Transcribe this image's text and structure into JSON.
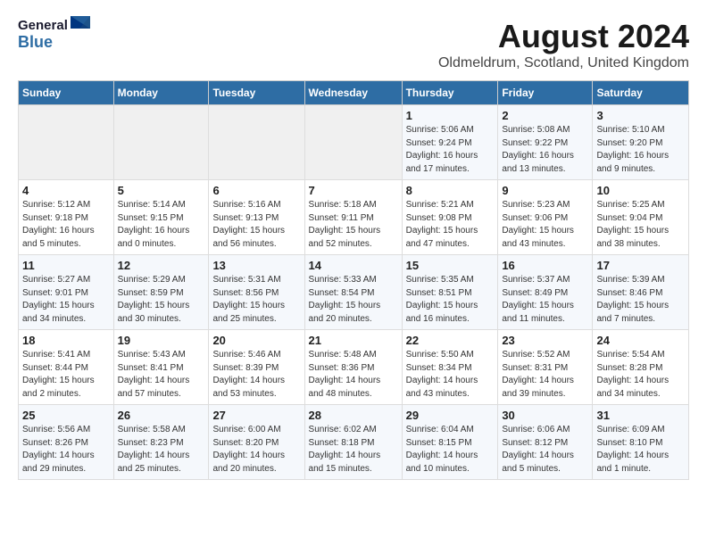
{
  "header": {
    "logo_general": "General",
    "logo_blue": "Blue",
    "title": "August 2024",
    "subtitle": "Oldmeldrum, Scotland, United Kingdom"
  },
  "days_of_week": [
    "Sunday",
    "Monday",
    "Tuesday",
    "Wednesday",
    "Thursday",
    "Friday",
    "Saturday"
  ],
  "weeks": [
    [
      {
        "day": "",
        "info": ""
      },
      {
        "day": "",
        "info": ""
      },
      {
        "day": "",
        "info": ""
      },
      {
        "day": "",
        "info": ""
      },
      {
        "day": "1",
        "info": "Sunrise: 5:06 AM\nSunset: 9:24 PM\nDaylight: 16 hours\nand 17 minutes."
      },
      {
        "day": "2",
        "info": "Sunrise: 5:08 AM\nSunset: 9:22 PM\nDaylight: 16 hours\nand 13 minutes."
      },
      {
        "day": "3",
        "info": "Sunrise: 5:10 AM\nSunset: 9:20 PM\nDaylight: 16 hours\nand 9 minutes."
      }
    ],
    [
      {
        "day": "4",
        "info": "Sunrise: 5:12 AM\nSunset: 9:18 PM\nDaylight: 16 hours\nand 5 minutes."
      },
      {
        "day": "5",
        "info": "Sunrise: 5:14 AM\nSunset: 9:15 PM\nDaylight: 16 hours\nand 0 minutes."
      },
      {
        "day": "6",
        "info": "Sunrise: 5:16 AM\nSunset: 9:13 PM\nDaylight: 15 hours\nand 56 minutes."
      },
      {
        "day": "7",
        "info": "Sunrise: 5:18 AM\nSunset: 9:11 PM\nDaylight: 15 hours\nand 52 minutes."
      },
      {
        "day": "8",
        "info": "Sunrise: 5:21 AM\nSunset: 9:08 PM\nDaylight: 15 hours\nand 47 minutes."
      },
      {
        "day": "9",
        "info": "Sunrise: 5:23 AM\nSunset: 9:06 PM\nDaylight: 15 hours\nand 43 minutes."
      },
      {
        "day": "10",
        "info": "Sunrise: 5:25 AM\nSunset: 9:04 PM\nDaylight: 15 hours\nand 38 minutes."
      }
    ],
    [
      {
        "day": "11",
        "info": "Sunrise: 5:27 AM\nSunset: 9:01 PM\nDaylight: 15 hours\nand 34 minutes."
      },
      {
        "day": "12",
        "info": "Sunrise: 5:29 AM\nSunset: 8:59 PM\nDaylight: 15 hours\nand 30 minutes."
      },
      {
        "day": "13",
        "info": "Sunrise: 5:31 AM\nSunset: 8:56 PM\nDaylight: 15 hours\nand 25 minutes."
      },
      {
        "day": "14",
        "info": "Sunrise: 5:33 AM\nSunset: 8:54 PM\nDaylight: 15 hours\nand 20 minutes."
      },
      {
        "day": "15",
        "info": "Sunrise: 5:35 AM\nSunset: 8:51 PM\nDaylight: 15 hours\nand 16 minutes."
      },
      {
        "day": "16",
        "info": "Sunrise: 5:37 AM\nSunset: 8:49 PM\nDaylight: 15 hours\nand 11 minutes."
      },
      {
        "day": "17",
        "info": "Sunrise: 5:39 AM\nSunset: 8:46 PM\nDaylight: 15 hours\nand 7 minutes."
      }
    ],
    [
      {
        "day": "18",
        "info": "Sunrise: 5:41 AM\nSunset: 8:44 PM\nDaylight: 15 hours\nand 2 minutes."
      },
      {
        "day": "19",
        "info": "Sunrise: 5:43 AM\nSunset: 8:41 PM\nDaylight: 14 hours\nand 57 minutes."
      },
      {
        "day": "20",
        "info": "Sunrise: 5:46 AM\nSunset: 8:39 PM\nDaylight: 14 hours\nand 53 minutes."
      },
      {
        "day": "21",
        "info": "Sunrise: 5:48 AM\nSunset: 8:36 PM\nDaylight: 14 hours\nand 48 minutes."
      },
      {
        "day": "22",
        "info": "Sunrise: 5:50 AM\nSunset: 8:34 PM\nDaylight: 14 hours\nand 43 minutes."
      },
      {
        "day": "23",
        "info": "Sunrise: 5:52 AM\nSunset: 8:31 PM\nDaylight: 14 hours\nand 39 minutes."
      },
      {
        "day": "24",
        "info": "Sunrise: 5:54 AM\nSunset: 8:28 PM\nDaylight: 14 hours\nand 34 minutes."
      }
    ],
    [
      {
        "day": "25",
        "info": "Sunrise: 5:56 AM\nSunset: 8:26 PM\nDaylight: 14 hours\nand 29 minutes."
      },
      {
        "day": "26",
        "info": "Sunrise: 5:58 AM\nSunset: 8:23 PM\nDaylight: 14 hours\nand 25 minutes."
      },
      {
        "day": "27",
        "info": "Sunrise: 6:00 AM\nSunset: 8:20 PM\nDaylight: 14 hours\nand 20 minutes."
      },
      {
        "day": "28",
        "info": "Sunrise: 6:02 AM\nSunset: 8:18 PM\nDaylight: 14 hours\nand 15 minutes."
      },
      {
        "day": "29",
        "info": "Sunrise: 6:04 AM\nSunset: 8:15 PM\nDaylight: 14 hours\nand 10 minutes."
      },
      {
        "day": "30",
        "info": "Sunrise: 6:06 AM\nSunset: 8:12 PM\nDaylight: 14 hours\nand 5 minutes."
      },
      {
        "day": "31",
        "info": "Sunrise: 6:09 AM\nSunset: 8:10 PM\nDaylight: 14 hours\nand 1 minute."
      }
    ]
  ]
}
